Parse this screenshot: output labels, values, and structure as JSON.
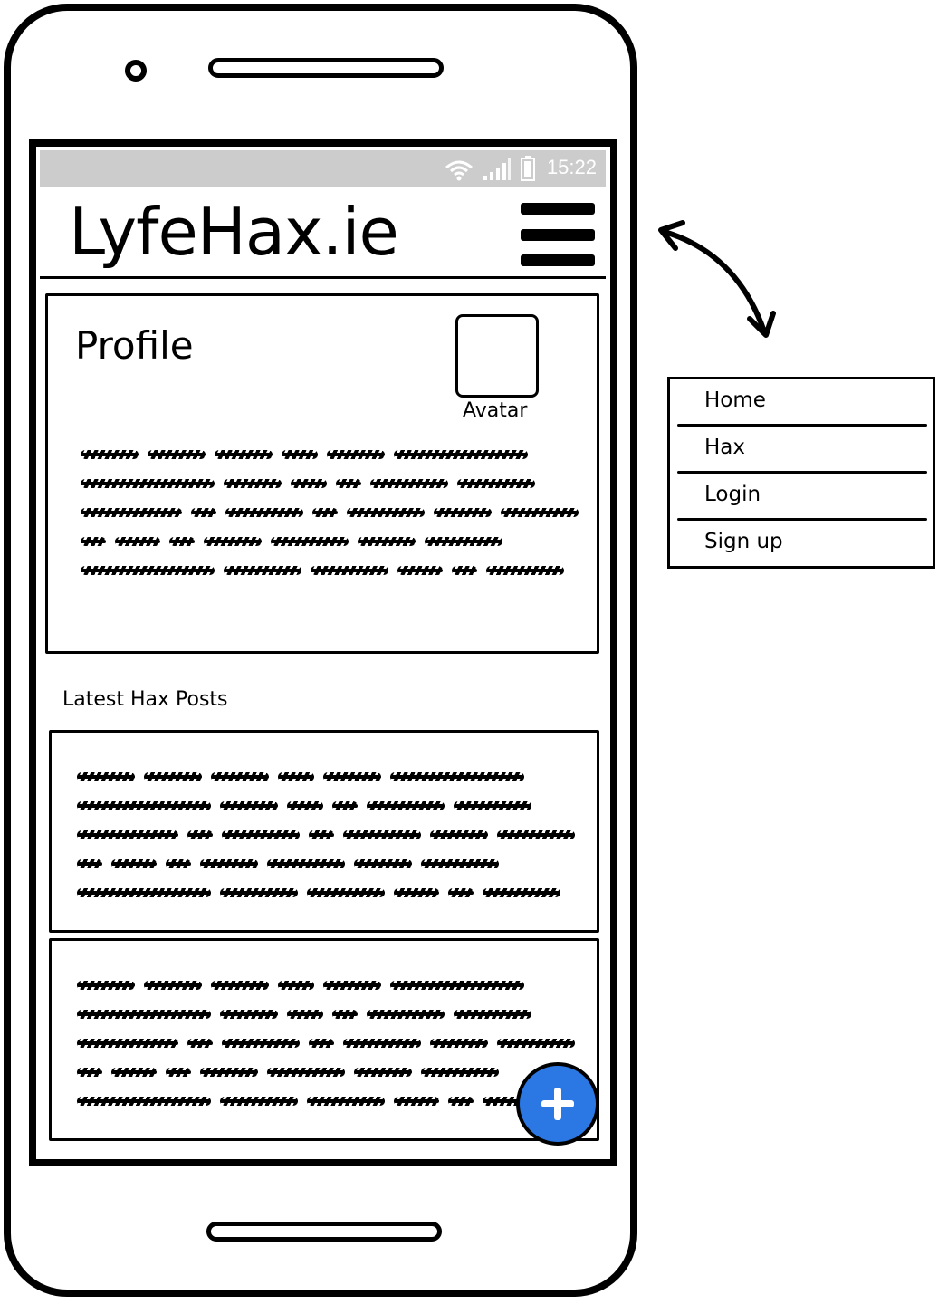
{
  "status_bar": {
    "time": "15:22",
    "icons": [
      "wifi-icon",
      "signal-icon",
      "battery-icon"
    ],
    "background": "#cccccc"
  },
  "app": {
    "title": "LyfeHax.ie",
    "menu_icon": "hamburger-menu-icon"
  },
  "profile": {
    "title": "Profile",
    "avatar_label": "Avatar"
  },
  "posts": {
    "heading": "Latest Hax Posts",
    "count_visible": 2
  },
  "fab": {
    "icon": "plus-icon",
    "color": "#2b78e4"
  },
  "nav_menu": {
    "items": [
      {
        "label": "Home"
      },
      {
        "label": "Hax"
      },
      {
        "label": "Login"
      },
      {
        "label": "Sign up"
      }
    ]
  }
}
